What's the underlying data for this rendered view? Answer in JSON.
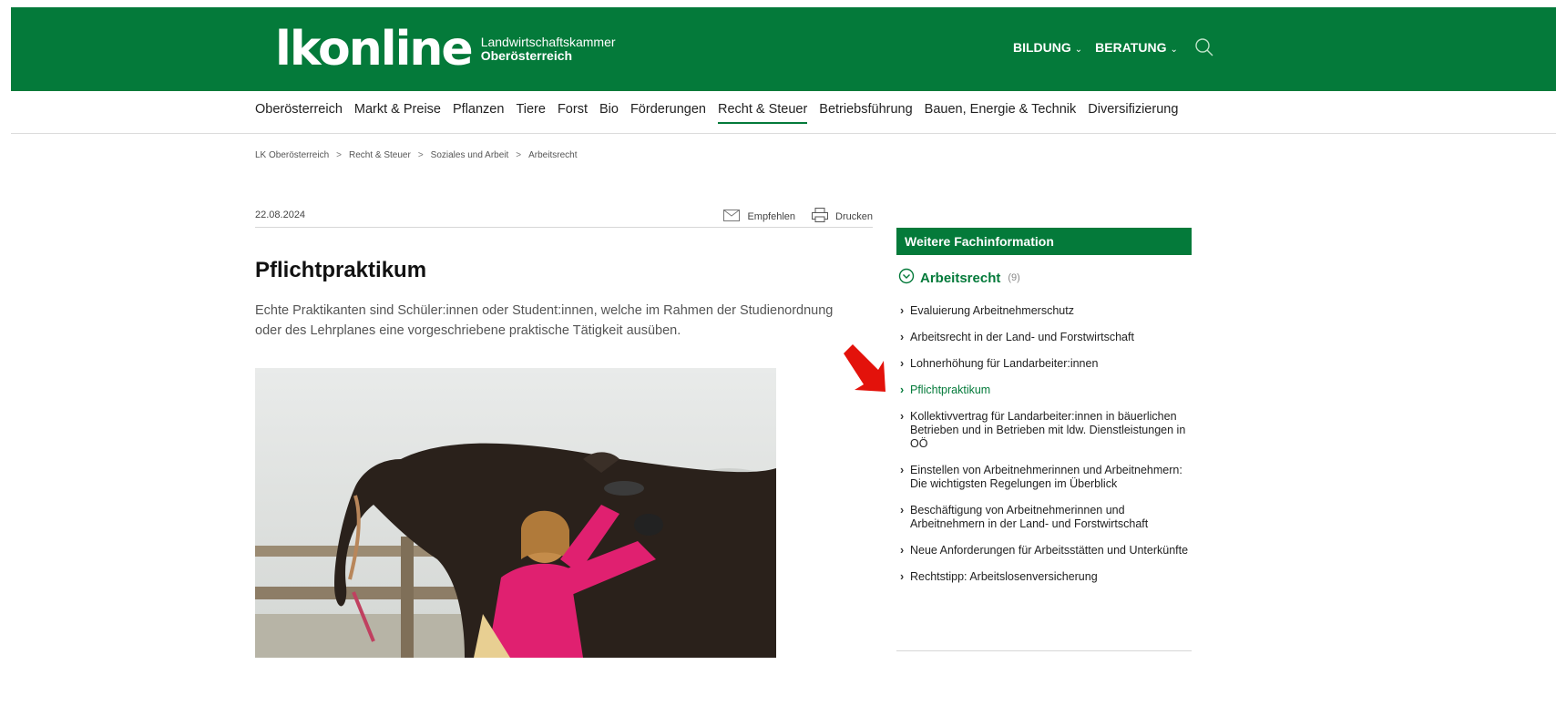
{
  "header": {
    "logo_main": "lkonline",
    "logo_line1": "Landwirtschaftskammer",
    "logo_line2": "Oberösterreich",
    "nav": [
      {
        "label": "BILDUNG"
      },
      {
        "label": "BERATUNG"
      }
    ],
    "brand_color": "#047a3a"
  },
  "main_nav": {
    "items": [
      {
        "label": "Oberösterreich"
      },
      {
        "label": "Markt & Preise"
      },
      {
        "label": "Pflanzen"
      },
      {
        "label": "Tiere"
      },
      {
        "label": "Forst"
      },
      {
        "label": "Bio"
      },
      {
        "label": "Förderungen"
      },
      {
        "label": "Recht & Steuer",
        "active": true
      },
      {
        "label": "Betriebsführung"
      },
      {
        "label": "Bauen, Energie & Technik"
      },
      {
        "label": "Diversifizierung"
      }
    ]
  },
  "breadcrumb": {
    "items": [
      "LK Oberösterreich",
      "Recht & Steuer",
      "Soziales und Arbeit",
      "Arbeitsrecht"
    ],
    "separator": ">"
  },
  "article": {
    "date": "22.08.2024",
    "recommend_label": "Empfehlen",
    "print_label": "Drucken",
    "title": "Pflichtpraktikum",
    "lead": "Echte Praktikanten sind Schüler:innen oder Student:innen, welche im Rahmen der Studienordnung oder des Lehrplanes eine vorgeschriebene praktische Tätigkeit ausüben."
  },
  "sidebar": {
    "heading": "Weitere Fachinformation",
    "category": "Arbeitsrecht",
    "count": "(9)",
    "items": [
      {
        "label": "Evaluierung Arbeitnehmerschutz"
      },
      {
        "label": "Arbeitsrecht in der Land- und Forstwirtschaft"
      },
      {
        "label": "Lohnerhöhung für Landarbeiter:innen"
      },
      {
        "label": "Pflichtpraktikum",
        "current": true
      },
      {
        "label": "Kollektivvertrag für Landarbeiter:innen in bäuerlichen Betrieben und in Betrieben mit ldw. Dienstleistungen in OÖ"
      },
      {
        "label": "Einstellen von Arbeitnehmerinnen und Arbeitnehmern: Die wichtigsten Regelungen im Überblick"
      },
      {
        "label": "Beschäftigung von Arbeitnehmerinnen und Arbeitnehmern in der Land- und Forstwirtschaft"
      },
      {
        "label": "Neue Anforderungen für Arbeitsstätten und Unterkünfte"
      },
      {
        "label": "Rechtstipp: Arbeitslosenversicherung"
      }
    ]
  }
}
